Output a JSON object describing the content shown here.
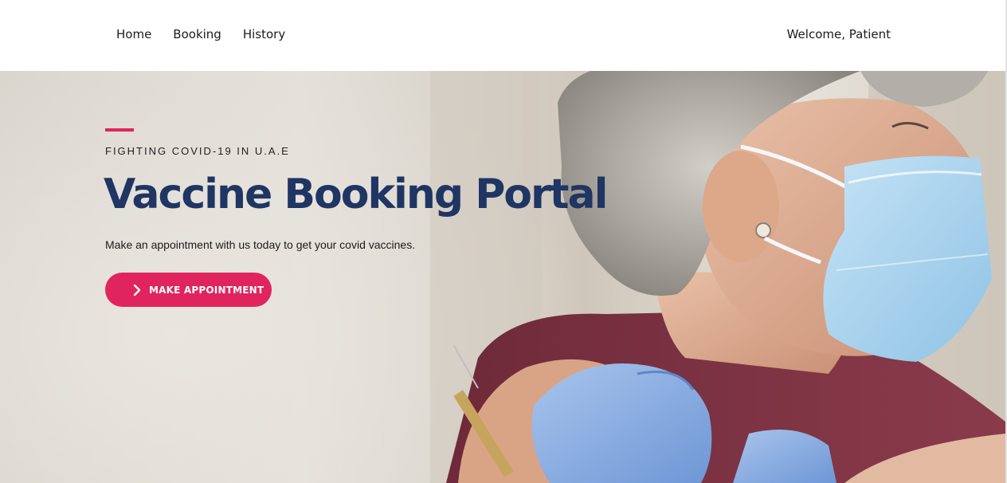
{
  "nav": {
    "items": [
      {
        "label": "Home"
      },
      {
        "label": "Booking"
      },
      {
        "label": "History"
      }
    ],
    "welcome": "Welcome, Patient"
  },
  "hero": {
    "eyebrow": "FIGHTING COVID-19 IN U.A.E",
    "title": "Vaccine Booking Portal",
    "subtitle": "Make an appointment with us today to get your covid vaccines.",
    "cta_label": "MAKE APPOINTMENT",
    "cta_icon": "chevron-right-icon",
    "photo": "elderly-woman-receiving-vaccine"
  },
  "colors": {
    "accent": "#e0245e",
    "title": "#1f3563",
    "text": "#1b1b1b"
  }
}
